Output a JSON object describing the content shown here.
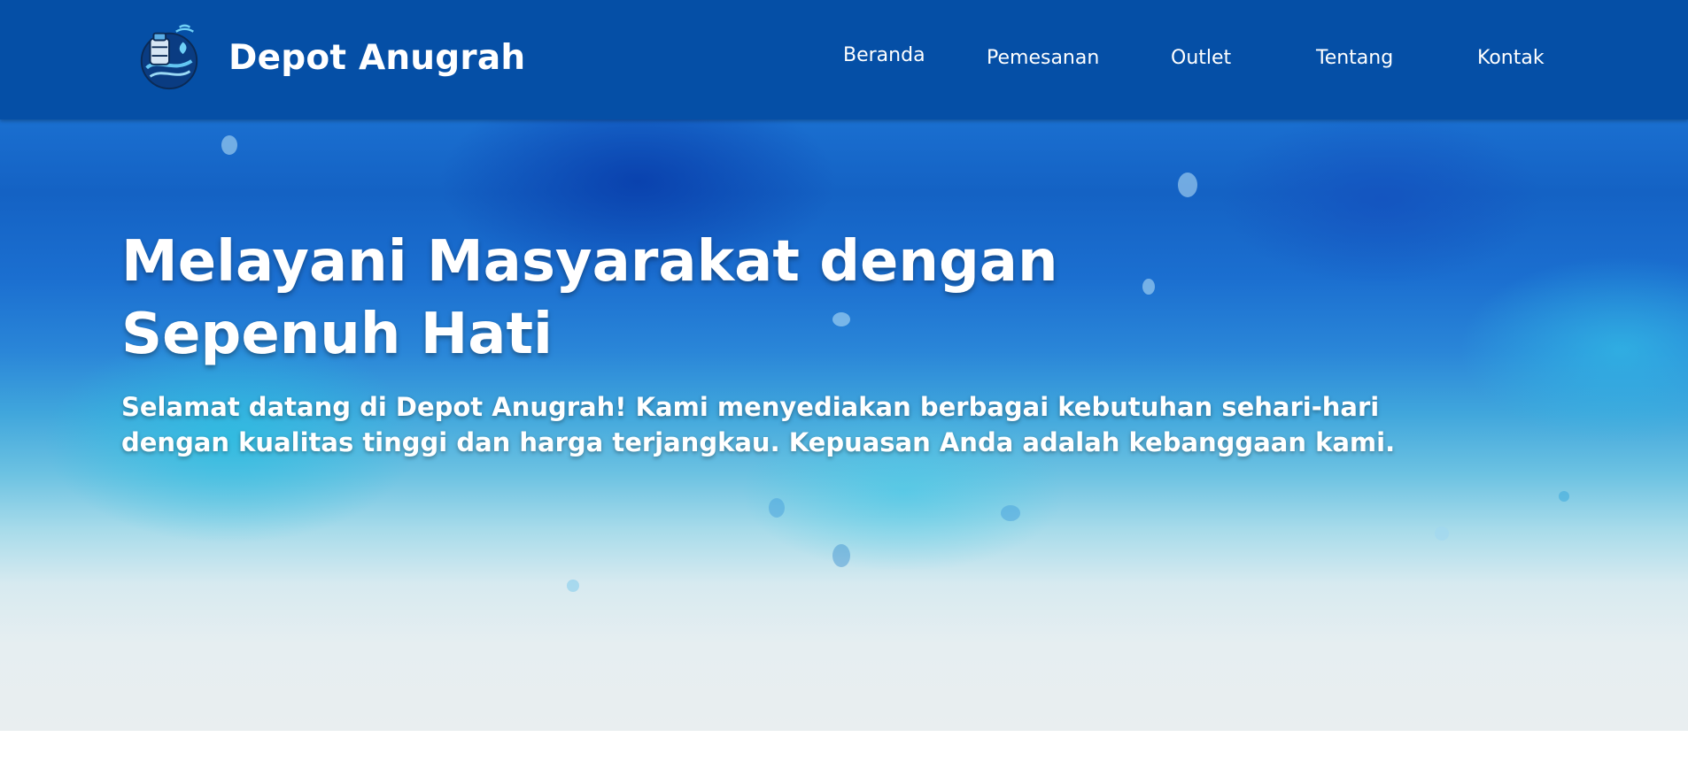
{
  "brand": {
    "name": "Depot Anugrah",
    "logo_icon": "water-depot-logo-icon"
  },
  "nav": {
    "items": [
      {
        "label": "Beranda"
      },
      {
        "label": "Pemesanan"
      },
      {
        "label": "Outlet"
      },
      {
        "label": "Tentang"
      },
      {
        "label": "Kontak"
      }
    ]
  },
  "hero": {
    "title_line1": "Melayani Masyarakat dengan",
    "title_line2": "Sepenuh Hati",
    "text_line1": "Selamat datang di Depot Anugrah! Kami menyediakan berbagai kebutuhan sehari-hari",
    "text_line2": "dengan kualitas tinggi dan harga terjangkau. Kepuasan Anda adalah kebanggaan kami."
  },
  "colors": {
    "navbar": "#054fa6",
    "text": "#ffffff",
    "hero_top": "#1a6fd0",
    "hero_bottom": "#e9eef0"
  }
}
